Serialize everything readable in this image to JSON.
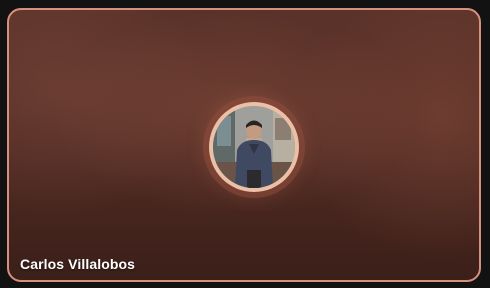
{
  "participant": {
    "name": "Carlos Villalobos",
    "avatar_icon": "profile-photo",
    "accent_color": "#d6907e"
  }
}
